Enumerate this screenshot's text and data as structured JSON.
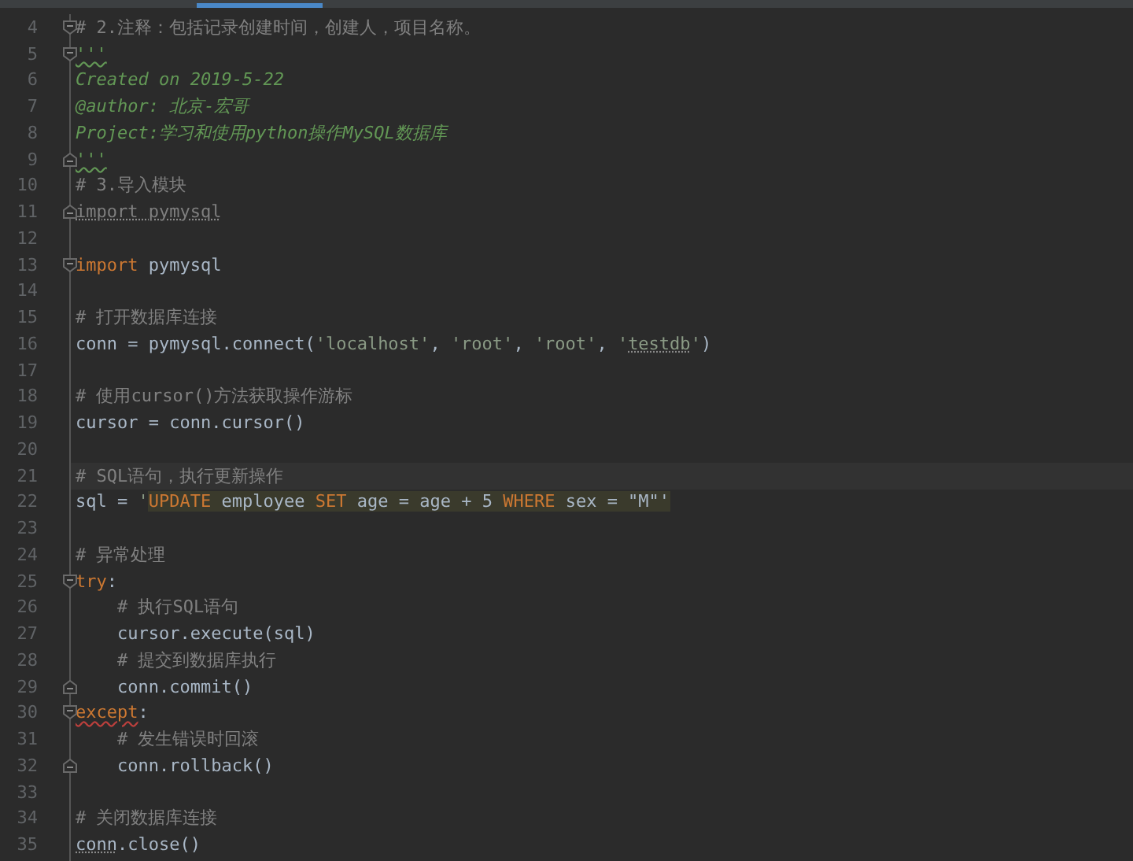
{
  "lines": [
    {
      "number": "4",
      "fold_open": true,
      "segments": [
        {
          "kind": "comment",
          "text": "# 2.注释：包括记录创建时间，创建人，项目名称。"
        }
      ]
    },
    {
      "number": "5",
      "fold_open": true,
      "segments": [
        {
          "kind": "doc",
          "text": "'''",
          "wavy": true
        }
      ]
    },
    {
      "number": "6",
      "segments": [
        {
          "kind": "doc",
          "text": "Created on 2019-5-22"
        }
      ]
    },
    {
      "number": "7",
      "segments": [
        {
          "kind": "doc",
          "text": "@author: 北京-宏哥"
        }
      ]
    },
    {
      "number": "8",
      "segments": [
        {
          "kind": "doc",
          "text": "Project:学习和使用python操作MySQL数据库"
        }
      ]
    },
    {
      "number": "9",
      "fold_close": true,
      "segments": [
        {
          "kind": "doc",
          "text": "'''",
          "wavy": true
        }
      ]
    },
    {
      "number": "10",
      "segments": [
        {
          "kind": "comment",
          "text": "# 3.导入模块"
        }
      ]
    },
    {
      "number": "11",
      "fold_close": true,
      "segments": [
        {
          "kind": "unused",
          "text": "import pymysql",
          "dotted": true
        }
      ]
    },
    {
      "number": "12"
    },
    {
      "number": "13",
      "fold_open": true,
      "segments": [
        {
          "kind": "keyword",
          "text": "import"
        },
        {
          "kind": "code",
          "text": " pymysql"
        }
      ]
    },
    {
      "number": "14"
    },
    {
      "number": "15",
      "segments": [
        {
          "kind": "comment",
          "text": "# 打开数据库连接"
        }
      ]
    },
    {
      "number": "16",
      "segments": [
        {
          "kind": "code",
          "text": "conn = pymysql.connect("
        },
        {
          "kind": "string",
          "text": "'localhost'"
        },
        {
          "kind": "code",
          "text": ", "
        },
        {
          "kind": "string",
          "text": "'root'"
        },
        {
          "kind": "code",
          "text": ", "
        },
        {
          "kind": "string",
          "text": "'root'"
        },
        {
          "kind": "code",
          "text": ", "
        },
        {
          "kind": "string",
          "text": "'"
        },
        {
          "kind": "string",
          "text": "testdb",
          "dotted": true
        },
        {
          "kind": "string",
          "text": "'"
        },
        {
          "kind": "code",
          "text": ")"
        }
      ]
    },
    {
      "number": "17"
    },
    {
      "number": "18",
      "segments": [
        {
          "kind": "comment",
          "text": "# 使用cursor()方法获取操作游标"
        }
      ]
    },
    {
      "number": "19",
      "segments": [
        {
          "kind": "code",
          "text": "cursor = conn.cursor()"
        }
      ]
    },
    {
      "number": "20"
    },
    {
      "number": "21",
      "current": true,
      "segments": [
        {
          "kind": "comment",
          "text": "# SQL语句，执行更新操作"
        }
      ]
    },
    {
      "number": "22",
      "segments": [
        {
          "kind": "code",
          "text": "sql = "
        },
        {
          "kind": "string",
          "text": "'"
        },
        {
          "kind": "sql_keyword",
          "text": "UPDATE"
        },
        {
          "kind": "sql",
          "text": " employee "
        },
        {
          "kind": "sql_keyword",
          "text": "SET"
        },
        {
          "kind": "sql",
          "text": " age = age + 5 "
        },
        {
          "kind": "sql_keyword",
          "text": "WHERE"
        },
        {
          "kind": "sql",
          "text": " sex = \"M\"'"
        }
      ]
    },
    {
      "number": "23"
    },
    {
      "number": "24",
      "segments": [
        {
          "kind": "comment",
          "text": "# 异常处理"
        }
      ]
    },
    {
      "number": "25",
      "fold_open": true,
      "segments": [
        {
          "kind": "keyword",
          "text": "try"
        },
        {
          "kind": "code",
          "text": ":"
        }
      ]
    },
    {
      "number": "26",
      "segments": [
        {
          "kind": "comment",
          "text": "    # 执行SQL语句"
        }
      ]
    },
    {
      "number": "27",
      "segments": [
        {
          "kind": "code",
          "text": "    cursor.execute(sql)"
        }
      ]
    },
    {
      "number": "28",
      "segments": [
        {
          "kind": "comment",
          "text": "    # 提交到数据库执行"
        }
      ]
    },
    {
      "number": "29",
      "fold_close": true,
      "segments": [
        {
          "kind": "code",
          "text": "    conn.commit()"
        }
      ]
    },
    {
      "number": "30",
      "fold_open": true,
      "segments": [
        {
          "kind": "keyword",
          "text": "except",
          "error": true
        },
        {
          "kind": "code",
          "text": ":"
        }
      ]
    },
    {
      "number": "31",
      "segments": [
        {
          "kind": "comment",
          "text": "    # 发生错误时回滚"
        }
      ]
    },
    {
      "number": "32",
      "fold_close": true,
      "segments": [
        {
          "kind": "code",
          "text": "    conn.rollback()"
        }
      ]
    },
    {
      "number": "33"
    },
    {
      "number": "34",
      "segments": [
        {
          "kind": "comment",
          "text": "# 关闭数据库连接"
        }
      ]
    },
    {
      "number": "35",
      "segments": [
        {
          "kind": "code",
          "text": "conn",
          "dotted": true
        },
        {
          "kind": "code",
          "text": ".close()"
        }
      ]
    }
  ]
}
